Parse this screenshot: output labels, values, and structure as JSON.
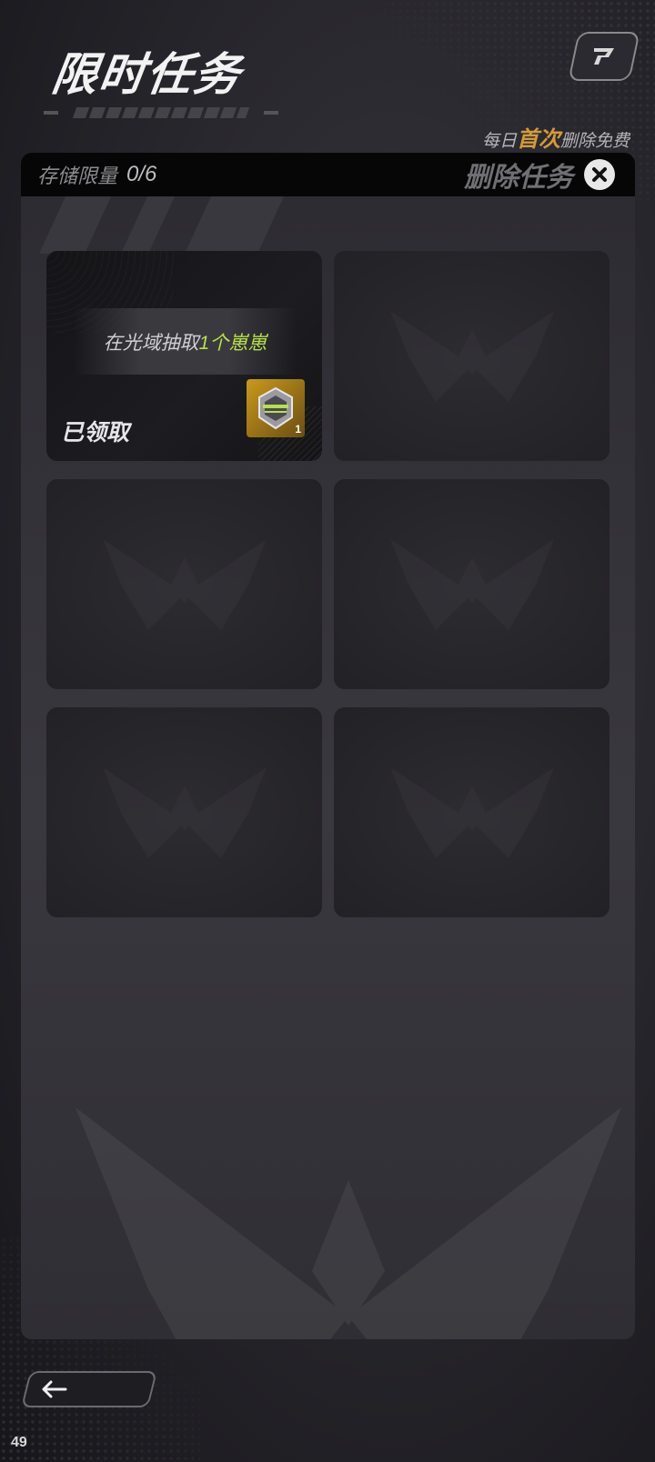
{
  "header": {
    "title": "限时任务",
    "daily_note": {
      "prefix": "每日",
      "highlight": "首次",
      "suffix": "删除免费"
    }
  },
  "panel": {
    "storage_label": "存储限量",
    "storage_count": "0/6",
    "delete_label": "删除任务"
  },
  "tasks": [
    {
      "desc_prefix": "在光域抽取",
      "desc_highlight": "1个崽崽",
      "status": "已领取",
      "reward_qty": "1"
    }
  ],
  "footer": {
    "page_number": "49"
  },
  "icons": {
    "share": "share-icon",
    "close": "close-icon",
    "back": "back-arrow-icon",
    "emblem": "emblem-icon",
    "reward": "reward-item-icon"
  },
  "colors": {
    "accent_orange": "#d49a3a",
    "accent_green": "#b6e14a"
  }
}
